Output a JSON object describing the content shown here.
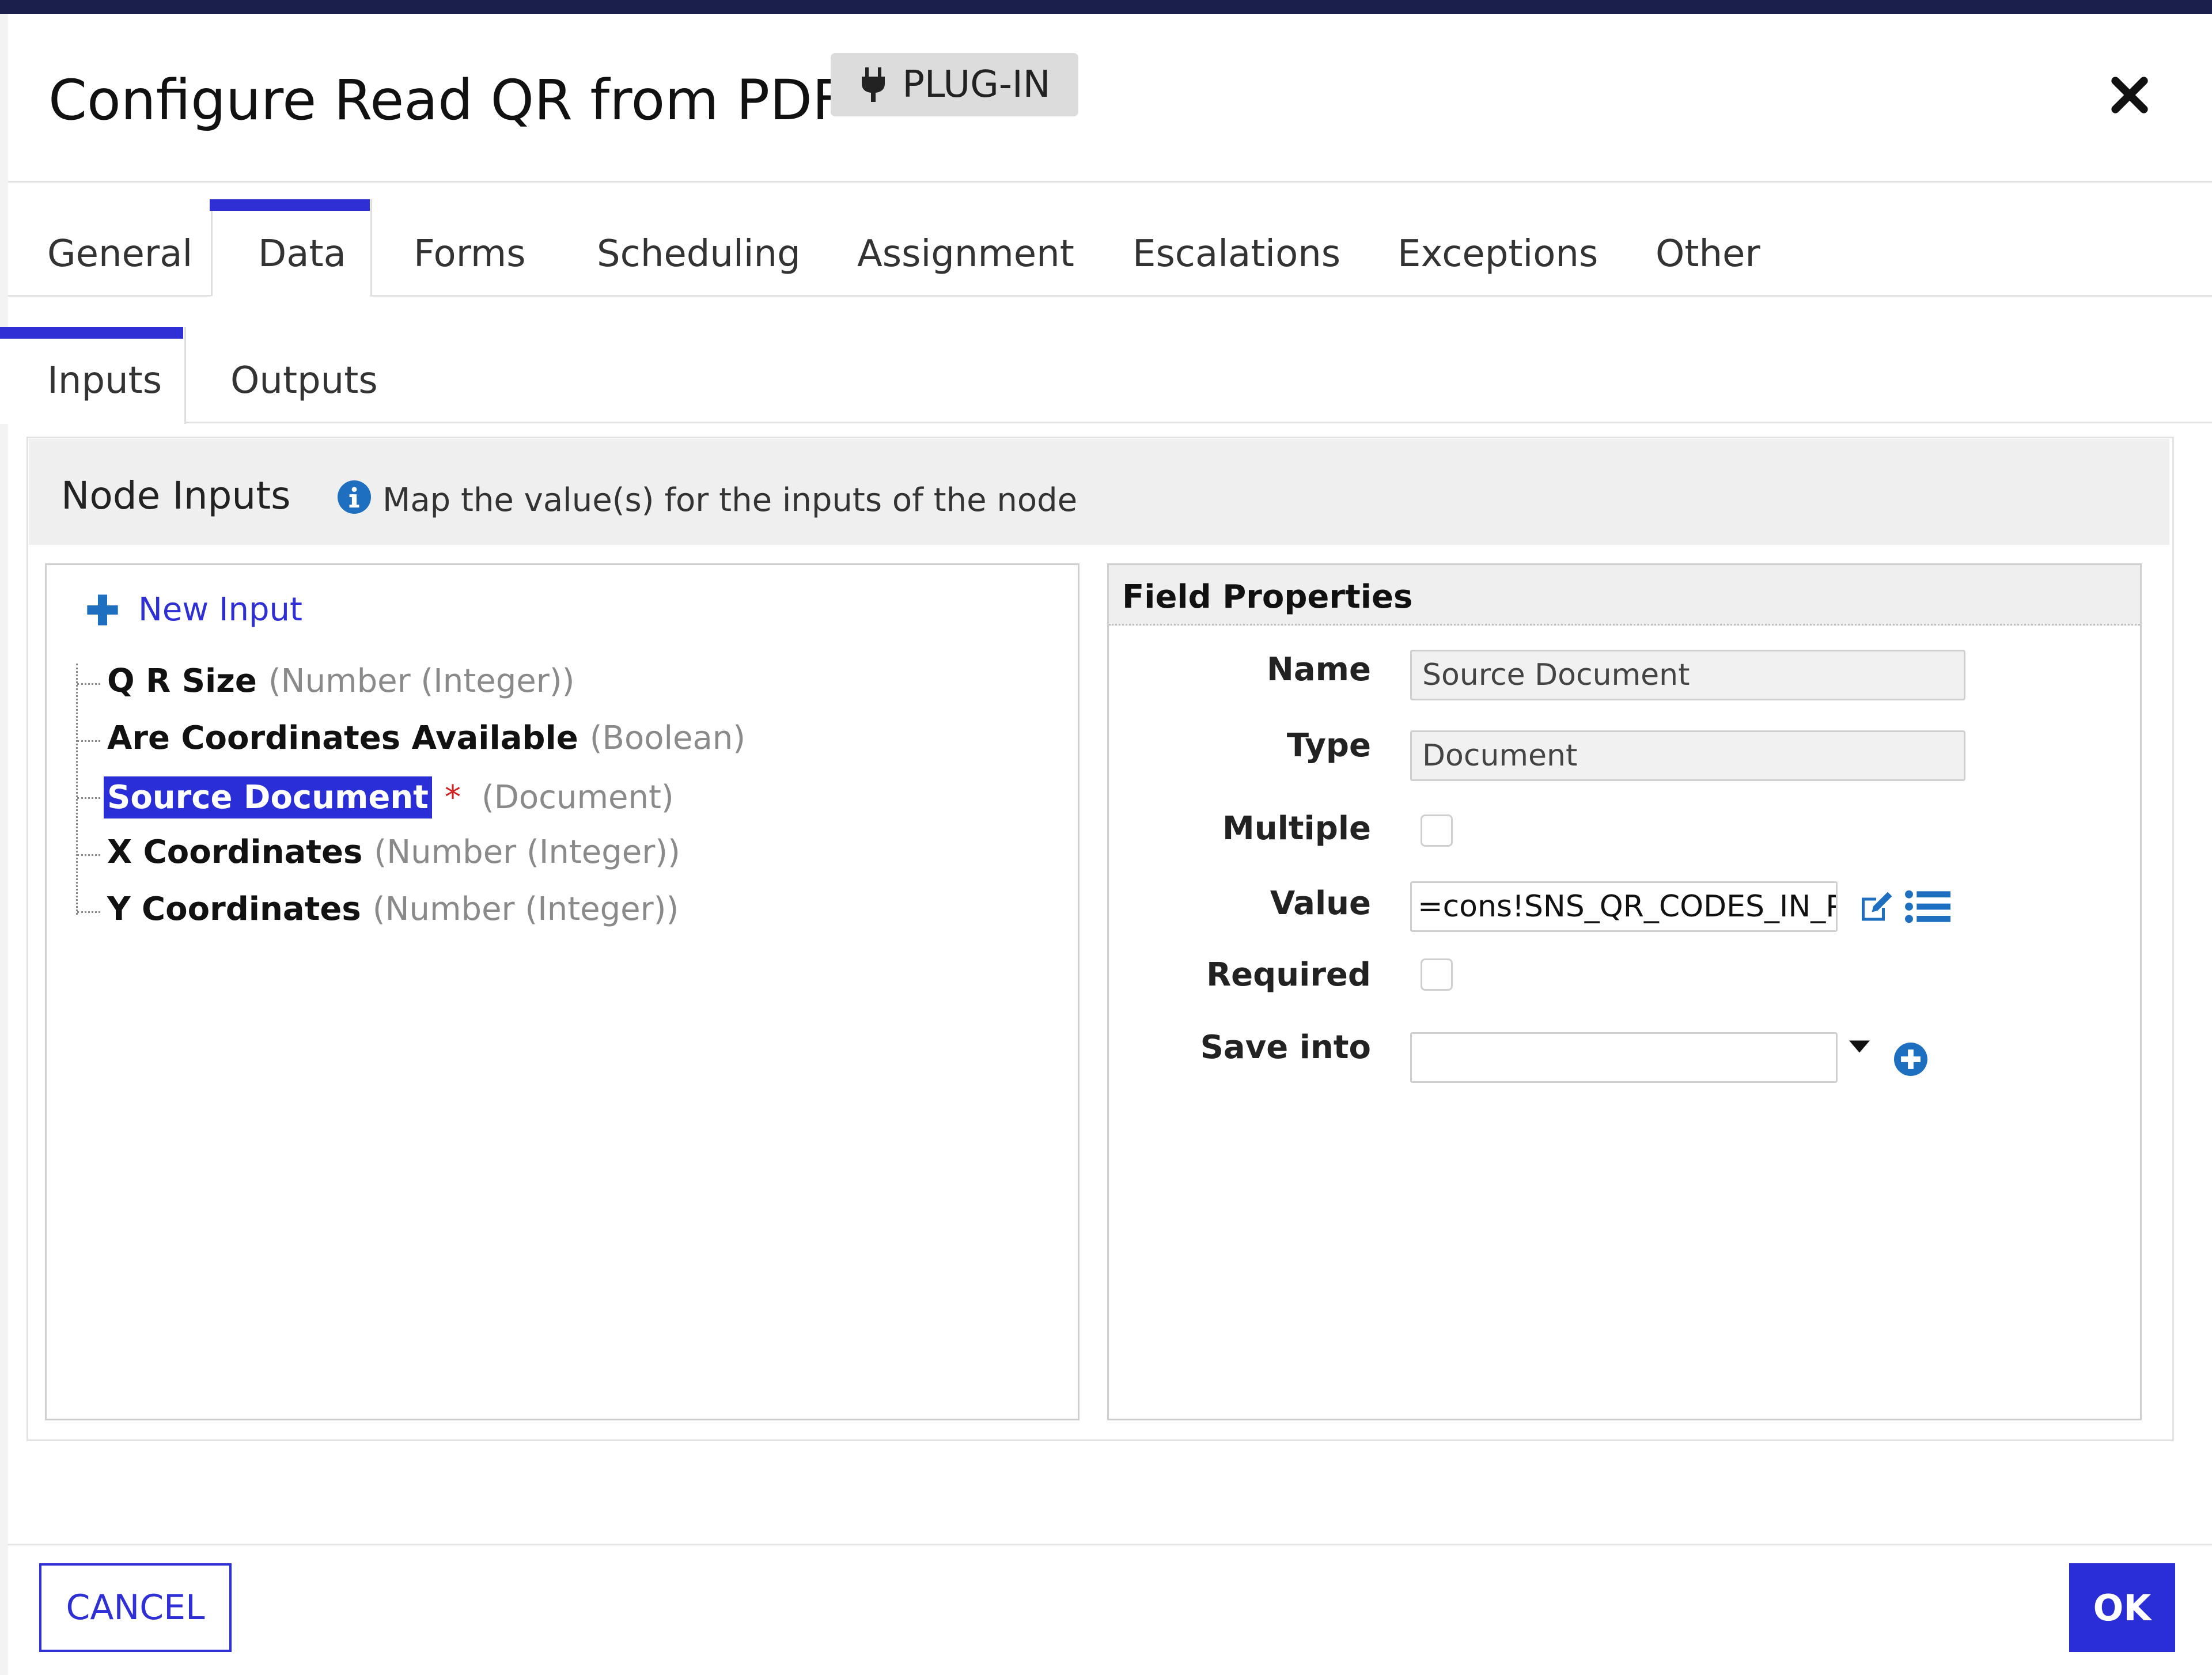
{
  "dialog": {
    "title": "Configure Read QR from PDF",
    "badge_label": "PLUG-IN",
    "badge_icon": "plug-icon",
    "close_icon": "close-icon"
  },
  "tabs": {
    "active": "Data",
    "items": [
      "General",
      "Data",
      "Forms",
      "Scheduling",
      "Assignment",
      "Escalations",
      "Exceptions",
      "Other"
    ]
  },
  "subtabs": {
    "active": "Inputs",
    "items": [
      "Inputs",
      "Outputs"
    ]
  },
  "node_inputs": {
    "title": "Node Inputs",
    "info_text": "Map the value(s) for the inputs of the node",
    "new_input_label": "New Input",
    "items": [
      {
        "name": "Q R Size",
        "type": "(Number (Integer))",
        "required": false,
        "selected": false
      },
      {
        "name": "Are Coordinates Available",
        "type": "(Boolean)",
        "required": false,
        "selected": false
      },
      {
        "name": "Source Document",
        "type": "(Document)",
        "required": true,
        "selected": true
      },
      {
        "name": "X Coordinates",
        "type": "(Number (Integer))",
        "required": false,
        "selected": false
      },
      {
        "name": "Y Coordinates",
        "type": "(Number (Integer))",
        "required": false,
        "selected": false
      }
    ],
    "required_marker": "*"
  },
  "field_properties": {
    "title": "Field Properties",
    "name_label": "Name",
    "name_value": "Source Document",
    "type_label": "Type",
    "type_value": "Document",
    "multiple_label": "Multiple",
    "multiple_checked": false,
    "value_label": "Value",
    "value_value": "=cons!SNS_QR_CODES_IN_PDF",
    "required_label": "Required",
    "required_checked": false,
    "save_into_label": "Save into",
    "save_into_value": ""
  },
  "footer": {
    "cancel_label": "CANCEL",
    "ok_label": "OK"
  },
  "colors": {
    "accent": "#2f2fd6",
    "selection": "#2a2ed6",
    "required": "#d02020",
    "info": "#1f6fc0",
    "topbar": "#1b1f4b"
  }
}
